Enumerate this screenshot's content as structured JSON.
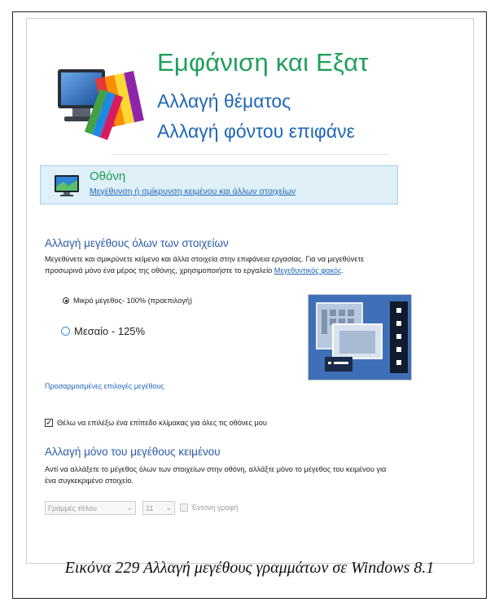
{
  "header": {
    "title": "Εμφάνιση και Εξατ",
    "link1": "Αλλαγή θέματος",
    "link2": "Αλλαγή φόντου επιφάνε"
  },
  "display_item": {
    "title": "Οθόνη",
    "link": "Μεγέθυνση ή σμίκρυνση κειμένου και άλλων στοιχείων"
  },
  "section_all": {
    "title": "Αλλαγή μεγέθους όλων των στοιχείων",
    "para_line1": "Μεγεθύνετε και σμικρύνετε κείμενο και άλλα στοιχεία στην επιφάνεια εργασίας. Για να μεγεθύνετε",
    "para_line2_a": "προσωρινά μόνο ένα μέρος της οθόνης, χρησιμοποιήστε το εργαλείο ",
    "para_line2_link": "Μεγεθυντικός φακός",
    "para_line2_b": "."
  },
  "radios": {
    "small": "Μικρό μέγεθος- 100% (προεπιλογή)",
    "medium": "Μεσαίο - 125%"
  },
  "custom_sizes_link": "Προσαρμοσμένες επιλογές μεγέθους",
  "scale_checkbox": {
    "label": "Θέλω να επιλέξω ένα επίπεδο κλίμακας για όλες τις οθόνες μου",
    "checked": true
  },
  "section_text": {
    "title": "Αλλαγή μόνο του μεγέθους κειμένου",
    "para_line1": "Αντί να αλλάξετε το μέγεθος όλων των στοιχείων στην οθόνη, αλλάξτε μόνο το μέγεθος του κειμένου για",
    "para_line2": "ένα συγκεκριμένο στοιχείο."
  },
  "controls": {
    "item_select": "Γραμμές τίτλου",
    "size_select": "11",
    "bold_label": "Έντονη γραφή"
  },
  "caption": "Εικόνα 229 Αλλαγή μεγέθους γραμμάτων σε Windows 8.1"
}
